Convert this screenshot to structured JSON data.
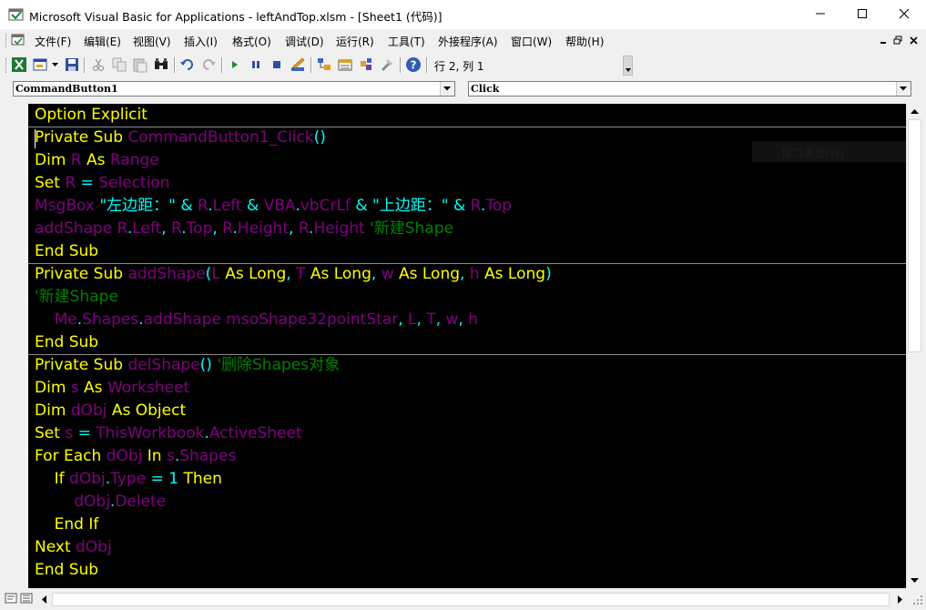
{
  "window": {
    "title": "Microsoft Visual Basic for Applications - leftAndTop.xlsm - [Sheet1 (代码)]"
  },
  "menu": [
    "文件(F)",
    "编辑(E)",
    "视图(V)",
    "插入(I)",
    "格式(O)",
    "调试(D)",
    "运行(R)",
    "工具(T)",
    "外接程序(A)",
    "窗口(W)",
    "帮助(H)"
  ],
  "toolbar": {
    "icons": [
      "excel-view-icon",
      "insert-userform-icon",
      "save-icon",
      "cut-icon",
      "copy-icon",
      "paste-icon",
      "find-icon",
      "undo-icon",
      "redo-icon",
      "run-icon",
      "break-icon",
      "reset-icon",
      "design-mode-icon",
      "project-explorer-icon",
      "properties-icon",
      "object-browser-icon",
      "toolbox-icon",
      "help-icon"
    ],
    "cursor_position": "行 2, 列 1"
  },
  "object_combo": {
    "value": "CommandButton1"
  },
  "procedure_combo": {
    "value": "Click"
  },
  "ghost_menu_text": "窗口重置(W)",
  "colors": {
    "keyword": "#ffff00",
    "identifier": "#800080",
    "operator": "#00ffff",
    "comment": "#008000",
    "code_background": "#000000"
  },
  "code": {
    "lines": [
      {
        "tokens": [
          [
            "kw",
            "Option Explicit"
          ]
        ]
      },
      {
        "tokens": [
          [
            "kw",
            "Private Sub "
          ],
          [
            "id",
            "CommandButton1_Click"
          ],
          [
            "op",
            "()"
          ]
        ]
      },
      {
        "tokens": [
          [
            "kw",
            "Dim "
          ],
          [
            "id",
            "R"
          ],
          [
            "kw",
            " As "
          ],
          [
            "id",
            "Range"
          ]
        ]
      },
      {
        "tokens": [
          [
            "kw",
            "Set "
          ],
          [
            "id",
            "R"
          ],
          [
            "op",
            " = "
          ],
          [
            "id",
            "Selection"
          ]
        ]
      },
      {
        "tokens": [
          [
            "id",
            "MsgBox"
          ],
          [
            "op",
            " \"左边距：\" & "
          ],
          [
            "id",
            "R"
          ],
          [
            "op",
            "."
          ],
          [
            "id",
            "Left"
          ],
          [
            "op",
            " & "
          ],
          [
            "id",
            "VBA"
          ],
          [
            "op",
            "."
          ],
          [
            "id",
            "vbCrLf"
          ],
          [
            "op",
            " & \"上边距：\" & "
          ],
          [
            "id",
            "R"
          ],
          [
            "op",
            "."
          ],
          [
            "id",
            "Top"
          ]
        ]
      },
      {
        "tokens": [
          [
            "id",
            "addShape R"
          ],
          [
            "op",
            "."
          ],
          [
            "id",
            "Left"
          ],
          [
            "op",
            ", "
          ],
          [
            "id",
            "R"
          ],
          [
            "op",
            "."
          ],
          [
            "id",
            "Top"
          ],
          [
            "op",
            ", "
          ],
          [
            "id",
            "R"
          ],
          [
            "op",
            "."
          ],
          [
            "id",
            "Height"
          ],
          [
            "op",
            ", "
          ],
          [
            "id",
            "R"
          ],
          [
            "op",
            "."
          ],
          [
            "id",
            "Height "
          ],
          [
            "cm",
            "'新建Shape"
          ]
        ]
      },
      {
        "tokens": [
          [
            "kw",
            "End Sub"
          ]
        ]
      },
      {
        "tokens": [
          [
            "kw",
            "Private Sub "
          ],
          [
            "id",
            "addShape"
          ],
          [
            "op",
            "("
          ],
          [
            "id",
            "L"
          ],
          [
            "kw",
            " As Long"
          ],
          [
            "op",
            ", "
          ],
          [
            "id",
            "T"
          ],
          [
            "kw",
            " As Long"
          ],
          [
            "op",
            ", "
          ],
          [
            "id",
            "w"
          ],
          [
            "kw",
            " As Long"
          ],
          [
            "op",
            ", "
          ],
          [
            "id",
            "h"
          ],
          [
            "kw",
            " As Long"
          ],
          [
            "op",
            ")"
          ]
        ]
      },
      {
        "tokens": [
          [
            "cm",
            "'新建Shape"
          ]
        ]
      },
      {
        "tokens": [
          [
            "id",
            "    Me"
          ],
          [
            "op",
            "."
          ],
          [
            "id",
            "Shapes"
          ],
          [
            "op",
            "."
          ],
          [
            "id",
            "addShape msoShape32pointStar"
          ],
          [
            "op",
            ", "
          ],
          [
            "id",
            "L"
          ],
          [
            "op",
            ", "
          ],
          [
            "id",
            "T"
          ],
          [
            "op",
            ", "
          ],
          [
            "id",
            "w"
          ],
          [
            "op",
            ", "
          ],
          [
            "id",
            "h"
          ]
        ]
      },
      {
        "tokens": [
          [
            "kw",
            "End Sub"
          ]
        ]
      },
      {
        "tokens": [
          [
            "kw",
            "Private Sub "
          ],
          [
            "id",
            "delShape"
          ],
          [
            "op",
            "() "
          ],
          [
            "cm",
            "'删除Shapes对象"
          ]
        ]
      },
      {
        "tokens": [
          [
            "kw",
            "Dim "
          ],
          [
            "id",
            "s"
          ],
          [
            "kw",
            " As "
          ],
          [
            "id",
            "Worksheet"
          ]
        ]
      },
      {
        "tokens": [
          [
            "kw",
            "Dim "
          ],
          [
            "id",
            "dObj"
          ],
          [
            "kw",
            " As Object"
          ]
        ]
      },
      {
        "tokens": [
          [
            "kw",
            "Set "
          ],
          [
            "id",
            "s"
          ],
          [
            "op",
            " = "
          ],
          [
            "id",
            "ThisWorkbook"
          ],
          [
            "op",
            "."
          ],
          [
            "id",
            "ActiveSheet"
          ]
        ]
      },
      {
        "tokens": [
          [
            "kw",
            "For Each "
          ],
          [
            "id",
            "dObj"
          ],
          [
            "kw",
            " In "
          ],
          [
            "id",
            "s"
          ],
          [
            "op",
            "."
          ],
          [
            "id",
            "Shapes"
          ]
        ]
      },
      {
        "tokens": [
          [
            "kw",
            "    If "
          ],
          [
            "id",
            "dObj"
          ],
          [
            "op",
            "."
          ],
          [
            "id",
            "Type"
          ],
          [
            "op",
            " = 1 "
          ],
          [
            "kw",
            "Then"
          ]
        ]
      },
      {
        "tokens": [
          [
            "id",
            "        dObj"
          ],
          [
            "op",
            "."
          ],
          [
            "id",
            "Delete"
          ]
        ]
      },
      {
        "tokens": [
          [
            "kw",
            "    End If"
          ]
        ]
      },
      {
        "tokens": [
          [
            "kw",
            "Next "
          ],
          [
            "id",
            "dObj"
          ]
        ]
      },
      {
        "tokens": [
          [
            "kw",
            "End Sub"
          ]
        ]
      }
    ]
  }
}
